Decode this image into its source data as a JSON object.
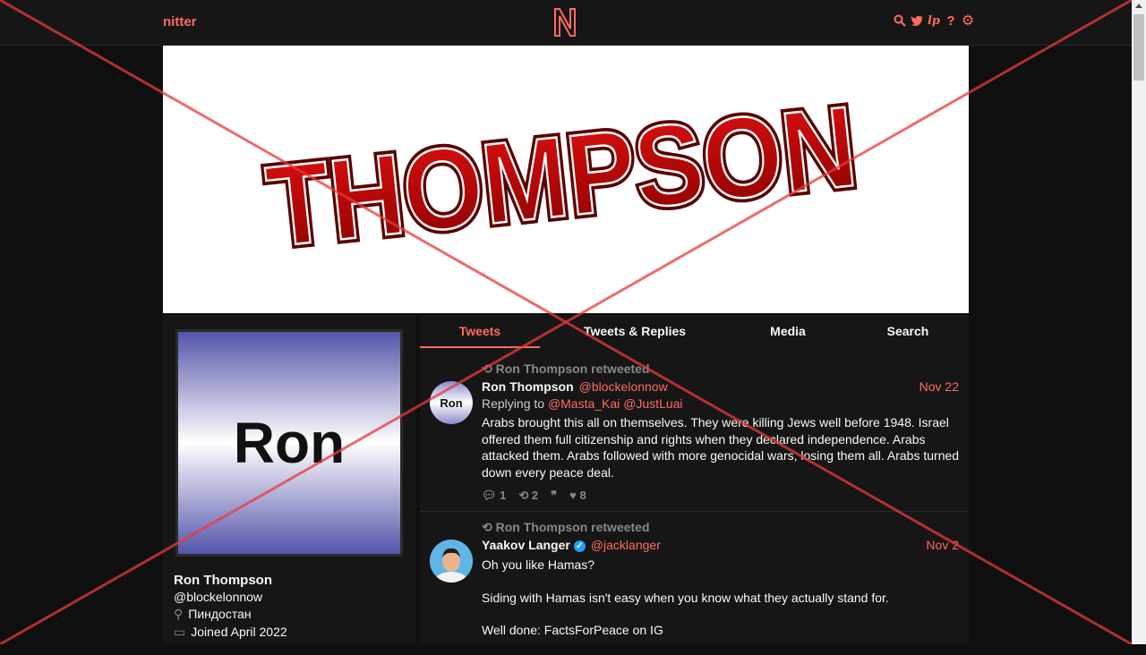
{
  "nav": {
    "brand": "nitter",
    "logo_letter": "N",
    "icons": [
      "search-icon",
      "twitter-bird-icon",
      "lp-icon",
      "help-icon",
      "gear-icon"
    ]
  },
  "banner": {
    "text": "THOMPSON"
  },
  "profile": {
    "avatar_text": "Ron",
    "name": "Ron Thompson",
    "handle": "@blockelonnow",
    "location": "Пиндостан",
    "joined": "Joined April 2022"
  },
  "tabs": [
    {
      "label": "Tweets",
      "active": true
    },
    {
      "label": "Tweets & Replies",
      "active": false
    },
    {
      "label": "Media",
      "active": false
    },
    {
      "label": "Search",
      "active": false
    }
  ],
  "tweets": [
    {
      "retweet_header": "Ron Thompson retweeted",
      "avatar_text": "Ron",
      "fullname": "Ron Thompson",
      "handle": "@blockelonnow",
      "date": "Nov 22",
      "replying_prefix": "Replying to",
      "replying_to": [
        "@Masta_Kai",
        "@JustLuai"
      ],
      "content": "Arabs brought this all on themselves.  They were killing Jews well before 1948.  Israel offered them full citizenship and rights when they declared independence.  Arabs attacked them.  Arabs followed with more genocidal wars, losing them all.  Arabs turned down every peace deal.",
      "stats": {
        "comments": "1",
        "retweets": "2",
        "quotes": "",
        "likes": "8"
      }
    },
    {
      "retweet_header": "Ron Thompson retweeted",
      "fullname": "Yaakov Langer",
      "verified": true,
      "handle": "@jacklanger",
      "date": "Nov 2",
      "content_lines": [
        "Oh you like Hamas?",
        "Siding with Hamas isn't easy when you know what they actually stand for.",
        "Well done: FactsForPeace on IG"
      ]
    }
  ],
  "colors": {
    "accent": "#ff6c60",
    "background": "#0f0f0f",
    "panel": "#161616"
  }
}
